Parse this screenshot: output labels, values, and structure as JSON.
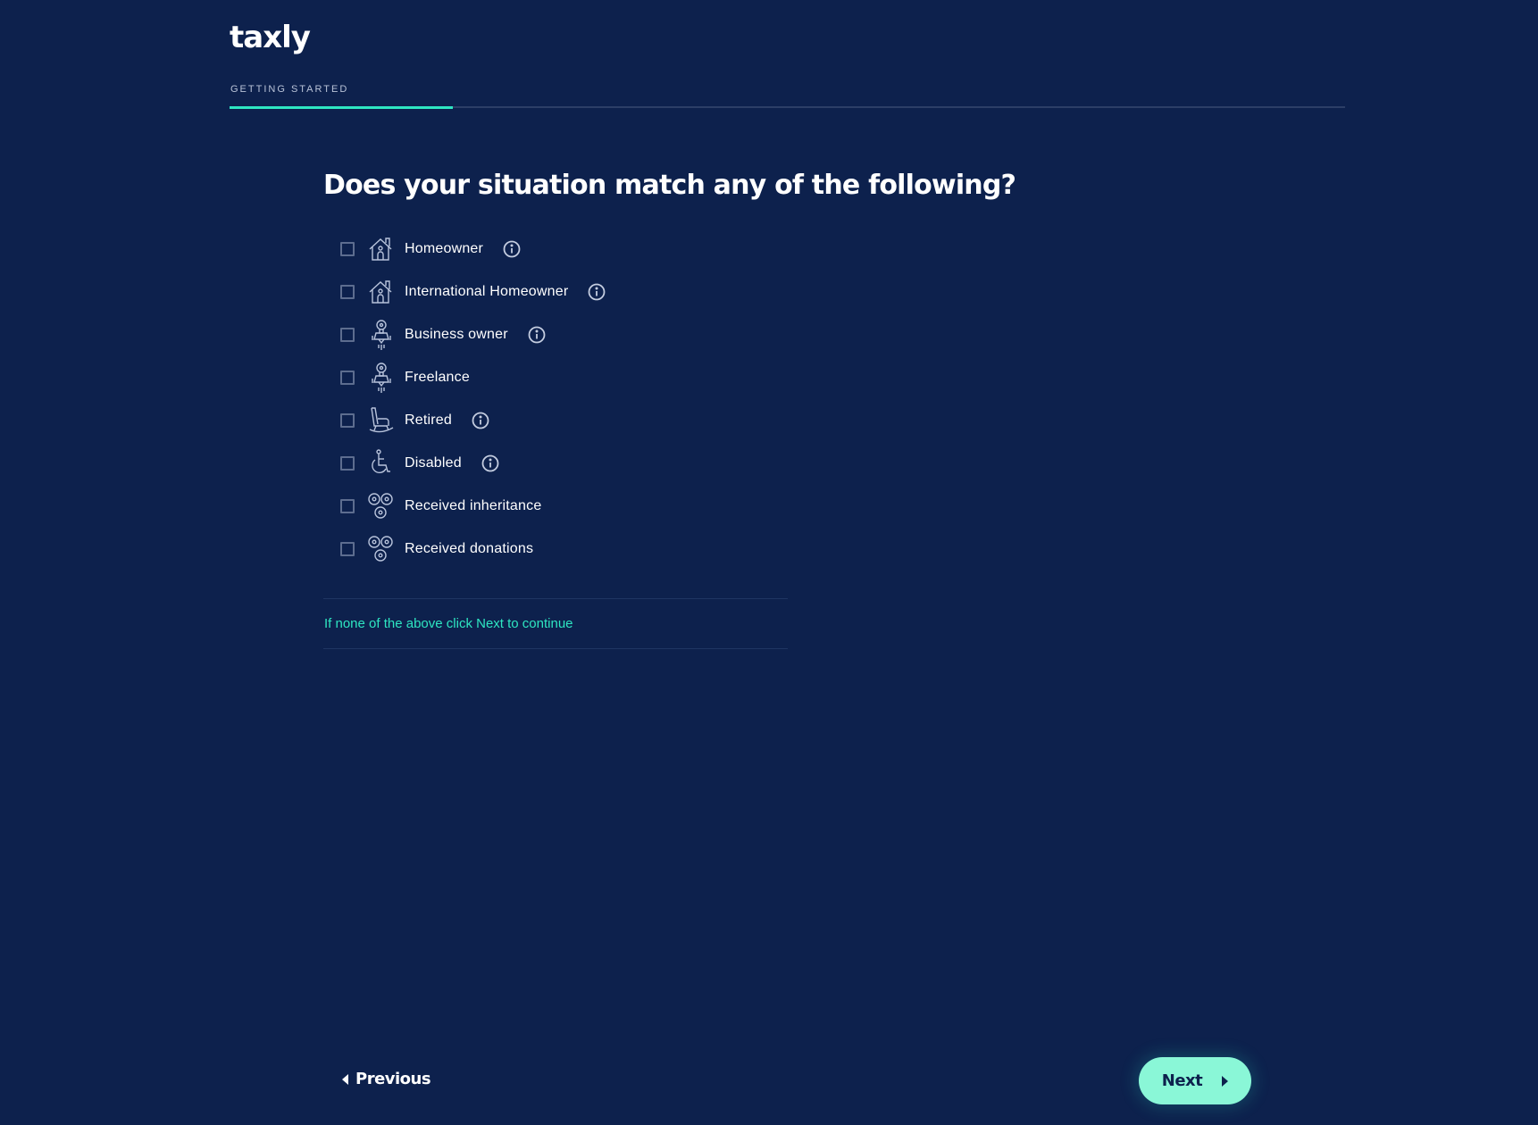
{
  "brand": {
    "logo_text": "taxly"
  },
  "progress": {
    "step_label": "GETTING STARTED",
    "percent": 20,
    "colors": {
      "fill": "#2ee6c2",
      "track": "#2c3e66"
    }
  },
  "question": {
    "title": "Does your situation match any of the following?",
    "options": [
      {
        "label": "Homeowner",
        "icon": "house-icon",
        "has_info": true,
        "checked": false
      },
      {
        "label": "International Homeowner",
        "icon": "house-icon",
        "has_info": true,
        "checked": false
      },
      {
        "label": "Business owner",
        "icon": "rocket-bulb-icon",
        "has_info": true,
        "checked": false
      },
      {
        "label": "Freelance",
        "icon": "rocket-bulb-icon",
        "has_info": false,
        "checked": false
      },
      {
        "label": "Retired",
        "icon": "rocking-chair-icon",
        "has_info": true,
        "checked": false
      },
      {
        "label": "Disabled",
        "icon": "wheelchair-icon",
        "has_info": true,
        "checked": false
      },
      {
        "label": "Received inheritance",
        "icon": "coins-icon",
        "has_info": false,
        "checked": false
      },
      {
        "label": "Received donations",
        "icon": "coins-icon",
        "has_info": false,
        "checked": false
      }
    ],
    "hint": "If none of the above click Next to continue"
  },
  "navigation": {
    "previous_label": "Previous",
    "next_label": "Next"
  },
  "colors": {
    "background": "#0d214d",
    "accent": "#2ee6c2",
    "next_button": "#8af7d7"
  }
}
